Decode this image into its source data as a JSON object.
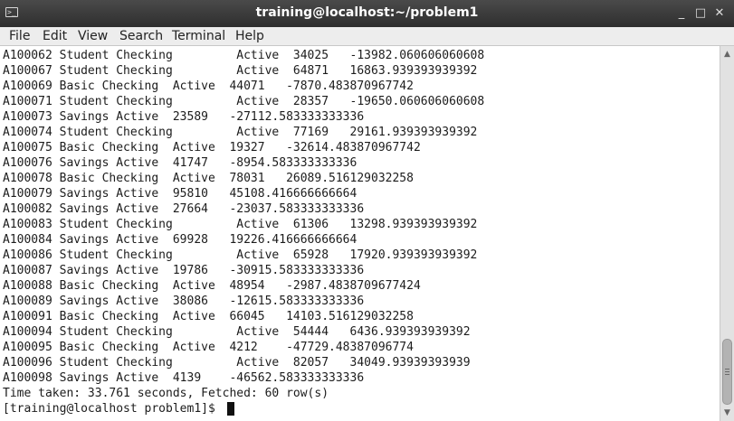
{
  "window": {
    "title": "training@localhost:~/problem1",
    "icon": "terminal-icon",
    "controls": {
      "minimize": "_",
      "maximize": "□",
      "close": "✕"
    }
  },
  "menubar": {
    "items": [
      "File",
      "Edit",
      "View",
      "Search",
      "Terminal",
      "Help"
    ]
  },
  "terminal": {
    "lines": [
      "A100062 Student Checking         Active  34025   -13982.060606060608",
      "A100067 Student Checking         Active  64871   16863.939393939392",
      "A100069 Basic Checking  Active  44071   -7870.483870967742",
      "A100071 Student Checking         Active  28357   -19650.060606060608",
      "A100073 Savings Active  23589   -27112.583333333336",
      "A100074 Student Checking         Active  77169   29161.939393939392",
      "A100075 Basic Checking  Active  19327   -32614.483870967742",
      "A100076 Savings Active  41747   -8954.583333333336",
      "A100078 Basic Checking  Active  78031   26089.516129032258",
      "A100079 Savings Active  95810   45108.416666666664",
      "A100082 Savings Active  27664   -23037.583333333336",
      "A100083 Student Checking         Active  61306   13298.939393939392",
      "A100084 Savings Active  69928   19226.416666666664",
      "A100086 Student Checking         Active  65928   17920.939393939392",
      "A100087 Savings Active  19786   -30915.583333333336",
      "A100088 Basic Checking  Active  48954   -2987.4838709677424",
      "A100089 Savings Active  38086   -12615.583333333336",
      "A100091 Basic Checking  Active  66045   14103.516129032258",
      "A100094 Student Checking         Active  54444   6436.939393939392",
      "A100095 Basic Checking  Active  4212    -47729.48387096774",
      "A100096 Student Checking         Active  82057   34049.93939393939",
      "A100098 Savings Active  4139    -46562.583333333336",
      "Time taken: 33.761 seconds, Fetched: 60 row(s)"
    ],
    "prompt": "[training@localhost problem1]$ "
  },
  "scrollbar": {
    "up_arrow": "▲",
    "down_arrow": "▼"
  }
}
